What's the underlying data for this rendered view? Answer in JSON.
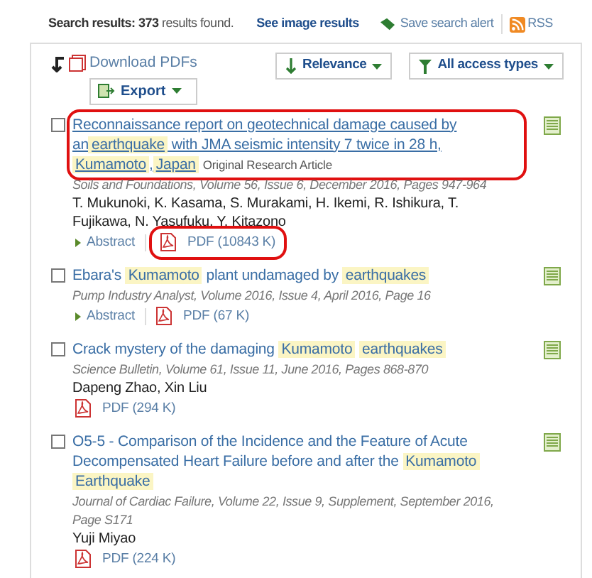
{
  "summary": {
    "label": "Search results:",
    "count": "373",
    "suffix": "results found."
  },
  "image_results_link": "See image results",
  "save_alert": "Save search alert",
  "rss": "RSS",
  "toolbar": {
    "download": "Download PDFs",
    "export": "Export",
    "sort": "Relevance",
    "access": "All access types"
  },
  "results": [
    {
      "title": [
        {
          "text": "Reconnaissance report on geotechnical damage caused by an",
          "highlighted": false
        },
        {
          "text": "earthquake",
          "highlighted": true
        },
        {
          "text": " with JMA seismic intensity 7 twice in 28 h, ",
          "highlighted": false
        },
        {
          "text": "Kumamoto",
          "highlighted": true
        },
        {
          "text": ",",
          "highlighted": false
        },
        {
          "text": "Japan",
          "highlighted": true
        }
      ],
      "article_type": "Original Research Article",
      "source": "Soils and Foundations, Volume 56, Issue 6, December 2016, Pages 947-964",
      "authors": "T. Mukunoki, K. Kasama, S. Murakami, H. Ikemi, R. Ishikura, T. Fujikawa, N. Yasufuku, Y. Kitazono",
      "abstract": "Abstract",
      "pdf": "PDF (10843 K)",
      "checked": false,
      "title_circled": true,
      "pdf_circled": true
    },
    {
      "title": [
        {
          "text": "Ebara's ",
          "highlighted": false
        },
        {
          "text": "Kumamoto",
          "highlighted": true
        },
        {
          "text": " plant undamaged by ",
          "highlighted": false
        },
        {
          "text": "earthquakes",
          "highlighted": true
        }
      ],
      "source": "Pump Industry Analyst, Volume 2016, Issue 4, April 2016, Page 16",
      "abstract": "Abstract",
      "pdf": "PDF (67 K)",
      "checked": false,
      "title_circled": false,
      "pdf_circled": false
    },
    {
      "title": [
        {
          "text": "Crack mystery of the damaging ",
          "highlighted": false
        },
        {
          "text": "Kumamoto",
          "highlighted": true
        },
        {
          "text": "earthquakes",
          "highlighted": true
        }
      ],
      "source": "Science Bulletin, Volume 61, Issue 11, June 2016, Pages 868-870",
      "authors": "Dapeng Zhao, Xin Liu",
      "pdf": "PDF (294 K)",
      "checked": false,
      "title_circled": false,
      "pdf_circled": false
    },
    {
      "title": [
        {
          "text": "O5-5 - Comparison of the Incidence and the Feature of Acute Decompensated Heart Failure before and after the ",
          "highlighted": false
        },
        {
          "text": "Kumamoto",
          "highlighted": true
        },
        {
          "text": "Earthquake",
          "highlighted": true
        }
      ],
      "source": "Journal of Cardiac Failure, Volume 22, Issue 9, Supplement, September 2016, Page S171",
      "authors": "Yuji Miyao",
      "pdf": "PDF (224 K)",
      "checked": false,
      "title_circled": false,
      "pdf_circled": false
    }
  ]
}
